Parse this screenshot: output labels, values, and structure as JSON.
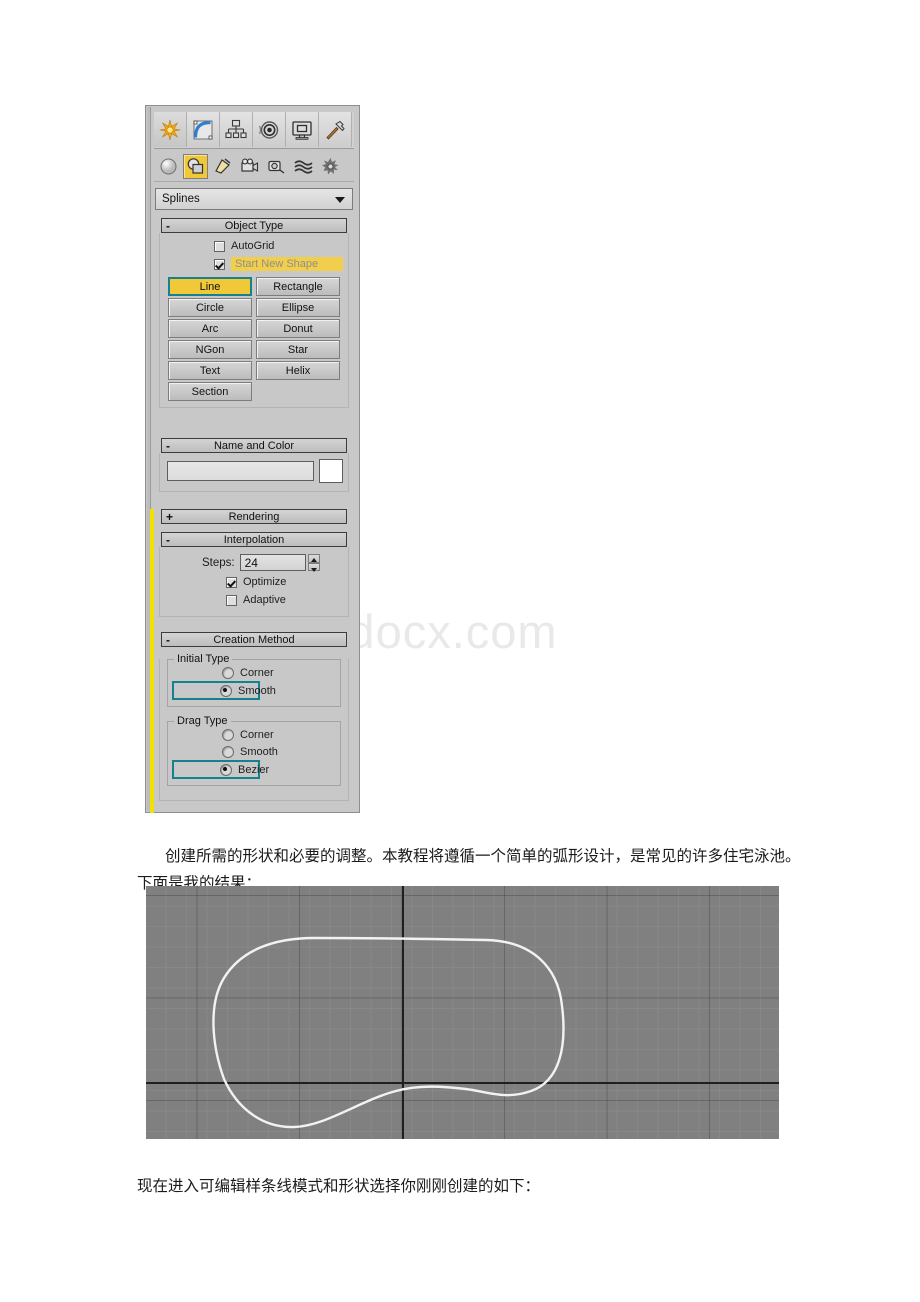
{
  "watermark": {
    "text": "www.bdocx.com"
  },
  "panel": {
    "tabs": [
      {
        "name": "create-tab",
        "icon": "star-icon",
        "selected": true
      },
      {
        "name": "modify-tab",
        "icon": "arc-bend-icon",
        "selected": false
      },
      {
        "name": "hierarchy-tab",
        "icon": "hierarchy-icon",
        "selected": false
      },
      {
        "name": "motion-tab",
        "icon": "wheel-icon",
        "selected": false
      },
      {
        "name": "display-tab",
        "icon": "monitor-icon",
        "selected": false
      },
      {
        "name": "utilities-tab",
        "icon": "hammer-icon",
        "selected": false
      }
    ],
    "categories": [
      {
        "name": "geometry-category",
        "icon": "sphere-icon",
        "selected": false
      },
      {
        "name": "shapes-category",
        "icon": "shapes-icon",
        "selected": true
      },
      {
        "name": "lights-category",
        "icon": "light-icon",
        "selected": false
      },
      {
        "name": "cameras-category",
        "icon": "camera-icon",
        "selected": false
      },
      {
        "name": "helpers-category",
        "icon": "tape-measure-icon",
        "selected": false
      },
      {
        "name": "space-warps-category",
        "icon": "waves-icon",
        "selected": false
      },
      {
        "name": "systems-category",
        "icon": "gear-sun-icon",
        "selected": false
      }
    ],
    "dropdown": {
      "value": "Splines",
      "icon": "chevron-down-icon"
    },
    "object_type": {
      "sign": "-",
      "title": "Object Type",
      "autogrid": {
        "label": "AutoGrid",
        "checked": false
      },
      "start_new_shape": {
        "label": "Start New Shape",
        "checked": true
      },
      "buttons": [
        {
          "label": "Line",
          "active": true
        },
        {
          "label": "Rectangle",
          "active": false
        },
        {
          "label": "Circle",
          "active": false
        },
        {
          "label": "Ellipse",
          "active": false
        },
        {
          "label": "Arc",
          "active": false
        },
        {
          "label": "Donut",
          "active": false
        },
        {
          "label": "NGon",
          "active": false
        },
        {
          "label": "Star",
          "active": false
        },
        {
          "label": "Text",
          "active": false
        },
        {
          "label": "Helix",
          "active": false
        },
        {
          "label": "Section",
          "active": false
        }
      ]
    },
    "name_and_color": {
      "sign": "-",
      "title": "Name and Color",
      "name_value": "",
      "color": "#ffffff"
    },
    "rendering": {
      "sign": "+",
      "title": "Rendering"
    },
    "interpolation": {
      "sign": "-",
      "title": "Interpolation",
      "steps_label": "Steps:",
      "steps_value": "24",
      "optimize": {
        "label": "Optimize",
        "checked": true
      },
      "adaptive": {
        "label": "Adaptive",
        "checked": false
      }
    },
    "creation_method": {
      "sign": "-",
      "title": "Creation Method",
      "initial_type": {
        "label": "Initial Type",
        "options": [
          {
            "label": "Corner",
            "selected": false,
            "highlighted": false
          },
          {
            "label": "Smooth",
            "selected": true,
            "highlighted": true
          }
        ]
      },
      "drag_type": {
        "label": "Drag Type",
        "options": [
          {
            "label": "Corner",
            "selected": false,
            "highlighted": false
          },
          {
            "label": "Smooth",
            "selected": false,
            "highlighted": false
          },
          {
            "label": "Bezier",
            "selected": true,
            "highlighted": true
          }
        ]
      }
    },
    "highlight_color": "#16808f",
    "accent_color": "#f0c838"
  },
  "body": {
    "paragraph1": "创建所需的形状和必要的调整。本教程将遵循一个简单的弧形设计，是常见的许多住宅泳池。下面是我的结果：",
    "paragraph2": "现在进入可编辑样条线模式和形状选择你刚刚创建的如下："
  },
  "viewport": {
    "background": "#808080",
    "spline_color": "#f2f2f2",
    "axis_color": "#1f1f1f",
    "description": "3ds Max top viewport showing a closed white kidney-shaped spline on a grey construction grid"
  }
}
